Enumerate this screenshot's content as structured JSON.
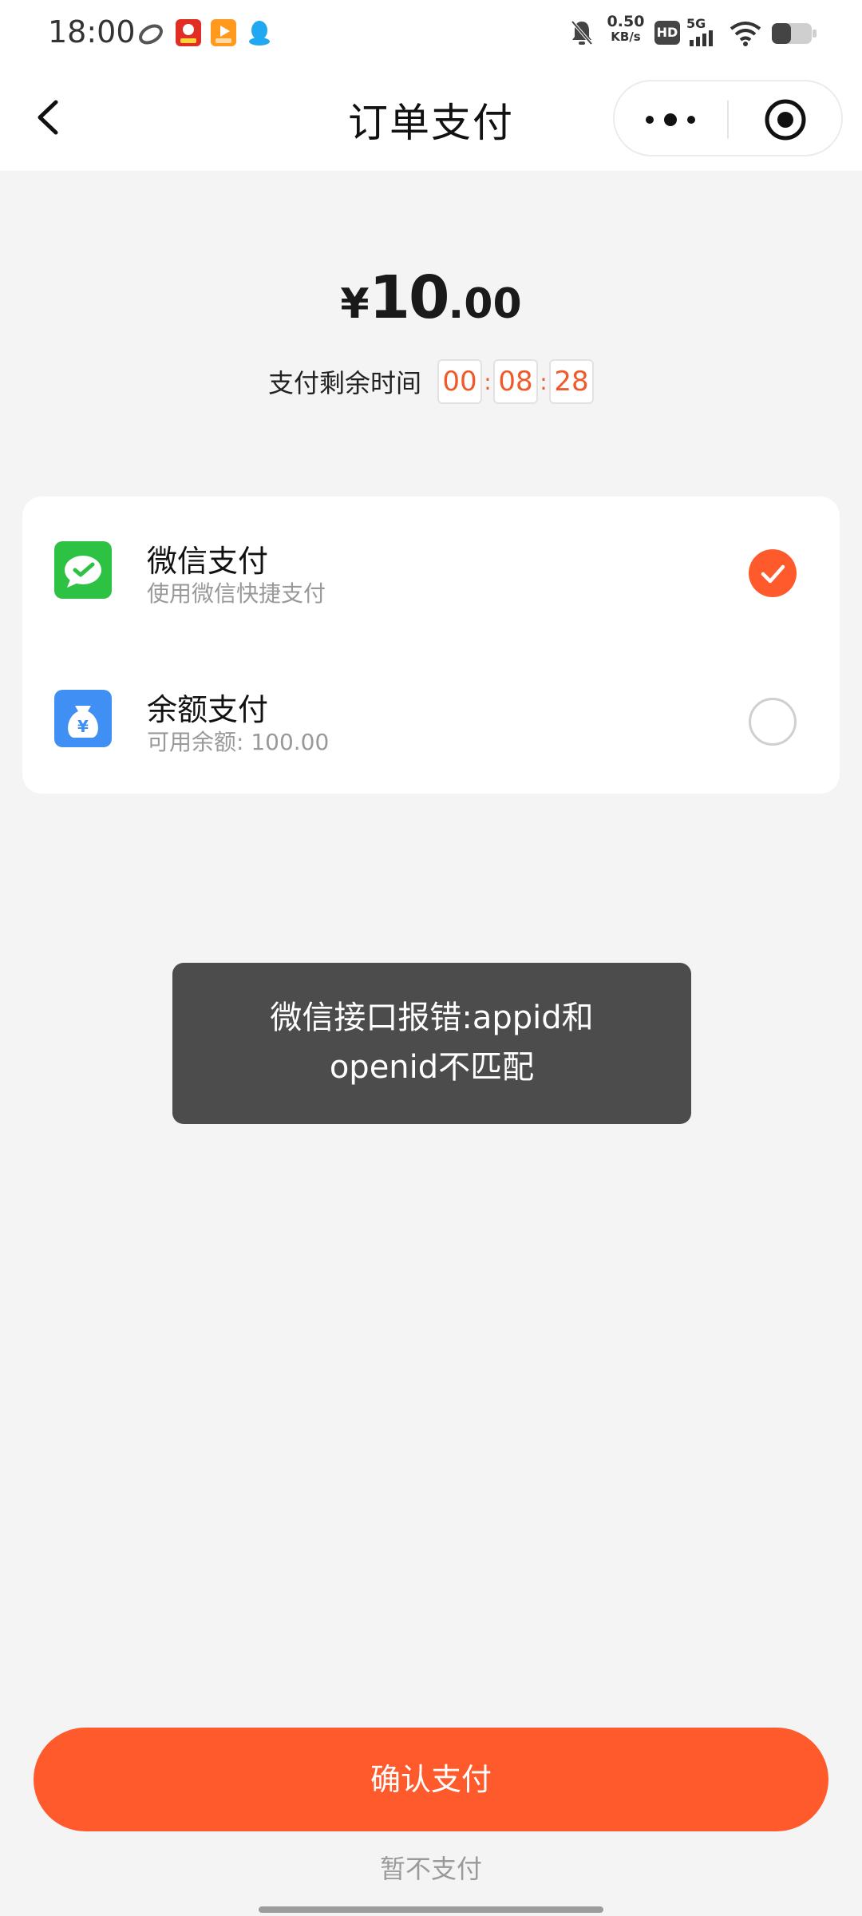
{
  "status_bar": {
    "time": "18:00",
    "net_speed_value": "0.50",
    "net_speed_unit": "KB/s",
    "hd_label": "HD",
    "signal_label": "5G"
  },
  "nav": {
    "title": "订单支付"
  },
  "order": {
    "currency": "¥",
    "amount_int": "10",
    "amount_dec": ".00",
    "timer_label": "支付剩余时间",
    "timer": {
      "hh": "00",
      "mm": "08",
      "ss": "28"
    },
    "timer_sep": ":"
  },
  "payment_methods": [
    {
      "title": "微信支付",
      "subtitle": "使用微信快捷支付",
      "selected": true
    },
    {
      "title": "余额支付",
      "subtitle": "可用余额: 100.00",
      "selected": false
    }
  ],
  "toast": {
    "line1": "微信接口报错:appid和",
    "line2": "openid不匹配"
  },
  "actions": {
    "confirm_label": "确认支付",
    "skip_label": "暂不支付"
  },
  "colors": {
    "accent": "#ff5a2c",
    "timer": "#f05a2b",
    "wechat_green": "#2dc243",
    "balance_blue": "#3f8ff5"
  }
}
